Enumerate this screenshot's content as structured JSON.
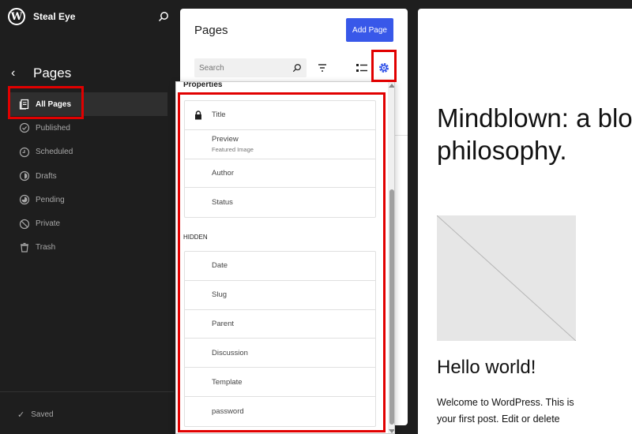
{
  "site": {
    "name": "Steal Eye",
    "logo_letter": "W"
  },
  "sidebar": {
    "back_label": "‹",
    "title": "Pages",
    "items": [
      {
        "label": "All Pages",
        "icon": "pages-icon",
        "active": true
      },
      {
        "label": "Published",
        "icon": "check-circle-icon",
        "active": false
      },
      {
        "label": "Scheduled",
        "icon": "clock-icon",
        "active": false
      },
      {
        "label": "Drafts",
        "icon": "draft-circle-icon",
        "active": false
      },
      {
        "label": "Pending",
        "icon": "pending-circle-icon",
        "active": false
      },
      {
        "label": "Private",
        "icon": "block-icon",
        "active": false
      },
      {
        "label": "Trash",
        "icon": "trash-icon",
        "active": false
      }
    ],
    "saved_label": "Saved"
  },
  "panel": {
    "title": "Pages",
    "add_button": "Add Page",
    "search_placeholder": "Search"
  },
  "dropdown": {
    "properties_label": "Properties",
    "properties": [
      {
        "label": "Title",
        "locked": true
      },
      {
        "label": "Preview",
        "sub": "Featured Image"
      },
      {
        "label": "Author"
      },
      {
        "label": "Status"
      }
    ],
    "hidden_label": "HIDDEN",
    "hidden": [
      {
        "label": "Date"
      },
      {
        "label": "Slug"
      },
      {
        "label": "Parent"
      },
      {
        "label": "Discussion"
      },
      {
        "label": "Template"
      },
      {
        "label": "password"
      }
    ]
  },
  "preview": {
    "hero": "Mindblown: a blog about\nphilosophy.",
    "post_title": "Hello world!",
    "post_excerpt": "Welcome to WordPress. This is your first post. Edit or delete"
  },
  "colors": {
    "accent": "#3858e9",
    "highlight": "#e10000",
    "sidebar_bg": "#1e1e1e"
  }
}
